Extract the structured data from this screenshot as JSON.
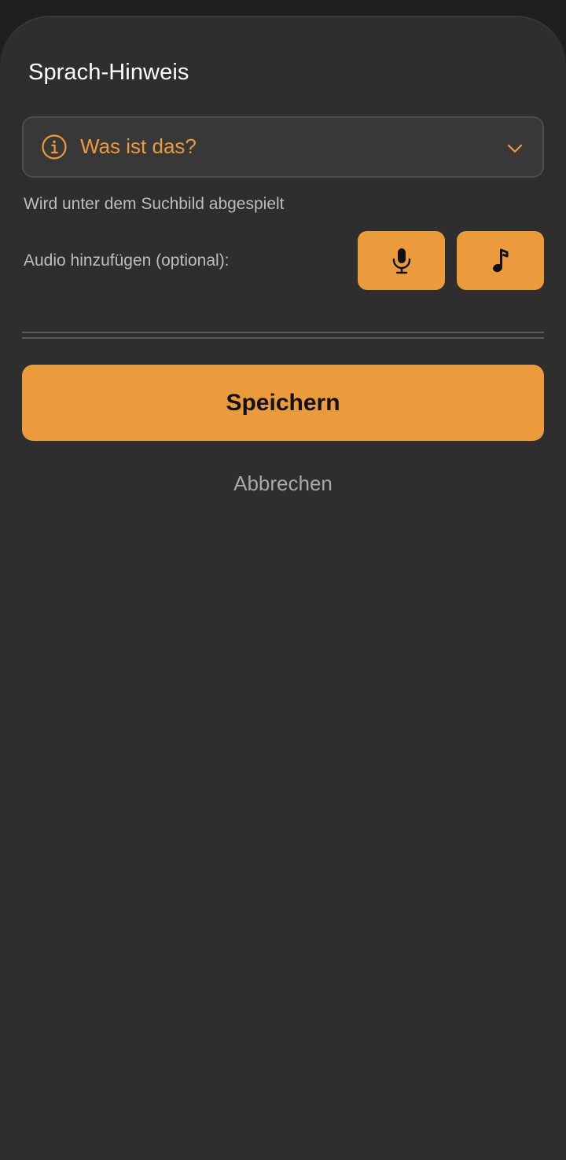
{
  "sheet": {
    "title": "Sprach-Hinweis"
  },
  "hint_select": {
    "selected": "Was ist das?",
    "icon": "info-icon",
    "chevron_icon": "chevron-down-icon"
  },
  "hint_text": "Wird unter dem Suchbild abgespielt",
  "audio": {
    "label": "Audio hinzufügen (optional):",
    "record_icon": "microphone-icon",
    "music_icon": "music-note-icon"
  },
  "actions": {
    "save_label": "Speichern",
    "cancel_label": "Abbrechen"
  },
  "colors": {
    "accent": "#eb9b3b",
    "background": "#2e2e2e",
    "field": "#383838"
  }
}
